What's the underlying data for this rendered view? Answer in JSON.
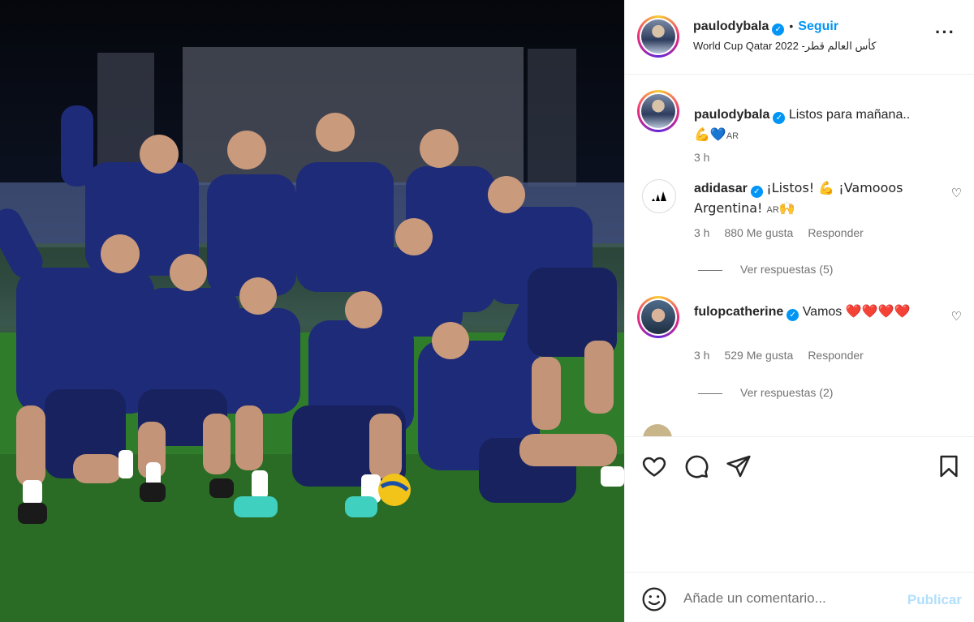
{
  "post": {
    "author": "paulodybala",
    "follow_label": "Seguir",
    "separator": "•",
    "location": "World Cup Qatar 2022 -كأس العالم قطر",
    "more_icon": "more-options-icon",
    "photo_alt_subject": ""
  },
  "caption": {
    "author": "paulodybala",
    "text": "Listos para mañana..",
    "emoji_line": "💪💙",
    "flag": "AR",
    "time": "3 h"
  },
  "comments": [
    {
      "author": "adidasar",
      "text": "¡Listos! 💪 ¡Vamooos Argentina! ",
      "flag": "AR",
      "tail_emoji": "🙌",
      "time": "3 h",
      "likes": "880 Me gusta",
      "reply": "Responder",
      "view_replies": "Ver respuestas (5)"
    },
    {
      "author": "fulopcatherine",
      "text": "Vamos ",
      "hearts": "❤️❤️❤️❤️",
      "time": "3 h",
      "likes": "529 Me gusta",
      "reply": "Responder",
      "view_replies": "Ver respuestas (2)"
    }
  ],
  "actions": {
    "like_icon": "heart-icon",
    "comment_icon": "comment-icon",
    "share_icon": "share-icon",
    "save_icon": "bookmark-icon"
  },
  "composer": {
    "placeholder": "Añade un comentario...",
    "publish_label": "Publicar",
    "emoji_icon": "smiley-icon"
  },
  "colors": {
    "link_blue": "#0095f6",
    "publish_disabled": "#b2dffc",
    "muted_text": "#737373",
    "jersey": "#1c2a73"
  }
}
